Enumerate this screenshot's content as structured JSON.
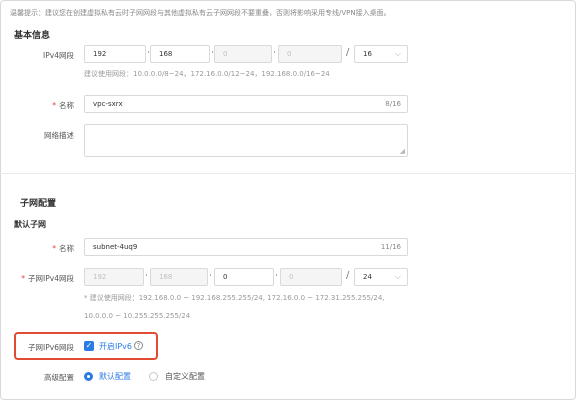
{
  "tip": "温馨提示：建议您在创建虚拟私有云时子网网段与其他虚拟私有云子网网段不要重叠，否则将影响采用专线/VPN接入桌面。",
  "basic": {
    "title": "基本信息",
    "ipv4_label": "IPv4网段",
    "ipv4": {
      "o1": "192",
      "o2": "168",
      "o3": "0",
      "o4": "0",
      "mask": "16"
    },
    "ipv4_hint": "建议使用网段：10.0.0.0/8~24，172.16.0.0/12~24，192.168.0.0/16~24",
    "name_label": "名称",
    "name_value": "vpc-sxrx",
    "name_count": "8/16",
    "desc_label": "网络描述",
    "desc_value": ""
  },
  "subnet": {
    "title": "子网配置",
    "default_title": "默认子网",
    "name_label": "名称",
    "name_value": "subnet-4uq9",
    "name_count": "11/16",
    "ipv4_label": "子网IPv4网段",
    "ipv4": {
      "o1": "192",
      "o2": "168",
      "o3": "0",
      "o4": "0",
      "mask": "24"
    },
    "hint_line1": "* 建议使用网段：192.168.0.0 ~ 192.168.255.255/24, 172.16.0.0 ~ 172.31.255.255/24,",
    "hint_line2": "10.0.0.0 ~ 10.255.255.255/24",
    "ipv6_label": "子网IPv6网段",
    "ipv6_checkbox_label": "开启IPv6",
    "ipv6_checked": true,
    "advanced_label": "高级配置",
    "advanced_options": [
      "默认配置",
      "自定义配置"
    ],
    "advanced_selected": "默认配置"
  },
  "symbols": {
    "required": "*",
    "dot": "·",
    "slash": "/",
    "chevron": "⌵",
    "resize": "◢",
    "check": "✓",
    "help": "?"
  },
  "colors": {
    "accent": "#2a7be4",
    "required": "#e83d2f",
    "highlight": "#e14b33"
  }
}
